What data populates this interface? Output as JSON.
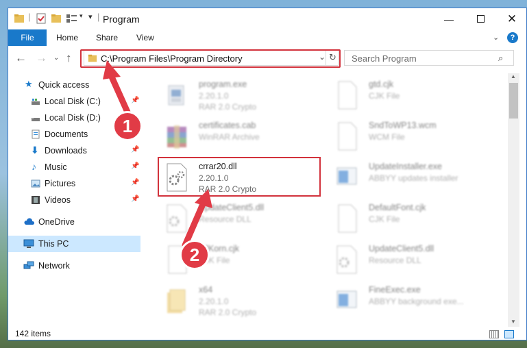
{
  "window": {
    "title": "Program"
  },
  "ribbon": {
    "tabs": [
      "File",
      "Home",
      "Share",
      "View"
    ]
  },
  "nav": {
    "address": "C:\\Program Files\\Program Directory",
    "search_placeholder": "Search Program"
  },
  "sidebar": {
    "items": [
      {
        "label": "Quick access",
        "icon": "star-icon"
      },
      {
        "label": "Local Disk (C:)",
        "icon": "drive-icon",
        "pinned": true
      },
      {
        "label": "Local Disk (D:)",
        "icon": "drive-icon",
        "pinned": false
      },
      {
        "label": "Documents",
        "icon": "documents-icon",
        "pinned": true
      },
      {
        "label": "Downloads",
        "icon": "download-icon",
        "pinned": true
      },
      {
        "label": "Music",
        "icon": "music-icon",
        "pinned": true
      },
      {
        "label": "Pictures",
        "icon": "pictures-icon",
        "pinned": true
      },
      {
        "label": "Videos",
        "icon": "videos-icon",
        "pinned": true
      },
      {
        "label": "OneDrive",
        "icon": "cloud-icon"
      },
      {
        "label": "This PC",
        "icon": "computer-icon",
        "selected": true
      },
      {
        "label": "Network",
        "icon": "network-icon"
      }
    ]
  },
  "files": [
    {
      "name": "program.exe",
      "line2": "2.20.1.0",
      "line3": "RAR 2.0 Crypto",
      "icon": "exe-icon",
      "blurred": true
    },
    {
      "name": "gtd.cjk",
      "line2": "CJK File",
      "line3": "",
      "icon": "blank-file-icon",
      "blurred": true
    },
    {
      "name": "certificates.cab",
      "line2": "WinRAR Archive",
      "line3": "",
      "icon": "winrar-icon",
      "blurred": true
    },
    {
      "name": "SndToWP13.wcm",
      "line2": "WCM File",
      "line3": "",
      "icon": "blank-file-icon",
      "blurred": true
    },
    {
      "name": "crrar20.dll",
      "line2": "2.20.1.0",
      "line3": "RAR 2.0 Crypto",
      "icon": "dll-icon",
      "blurred": false
    },
    {
      "name": "UpdateInstaller.exe",
      "line2": "ABBYY updates installer",
      "line3": "",
      "icon": "exe-window-icon",
      "blurred": true
    },
    {
      "name": "UpdateClient5.dll",
      "line2": "Resource DLL",
      "line3": "",
      "icon": "dll-icon",
      "blurred": true
    },
    {
      "name": "DefaultFont.cjk",
      "line2": "CJK File",
      "line3": "",
      "icon": "blank-file-icon",
      "blurred": true
    },
    {
      "name": "AllKorn.cjk",
      "line2": "CJK File",
      "line3": "",
      "icon": "blank-file-icon",
      "blurred": true
    },
    {
      "name": "UpdateClient5.dll",
      "line2": "Resource DLL",
      "line3": "",
      "icon": "dll-icon",
      "blurred": true
    },
    {
      "name": "x64",
      "line2": "2.20.1.0",
      "line3": "RAR 2.0 Crypto",
      "icon": "folder-icon",
      "blurred": true
    },
    {
      "name": "FineExec.exe",
      "line2": "ABBYY background exe...",
      "line3": "",
      "icon": "exe-window-icon",
      "blurred": true
    }
  ],
  "status": {
    "items_count": "142 items"
  },
  "callouts": [
    "1",
    "2"
  ],
  "colors": {
    "accent": "#1979ca",
    "highlight": "#d2323c",
    "callout": "#e13b46"
  }
}
